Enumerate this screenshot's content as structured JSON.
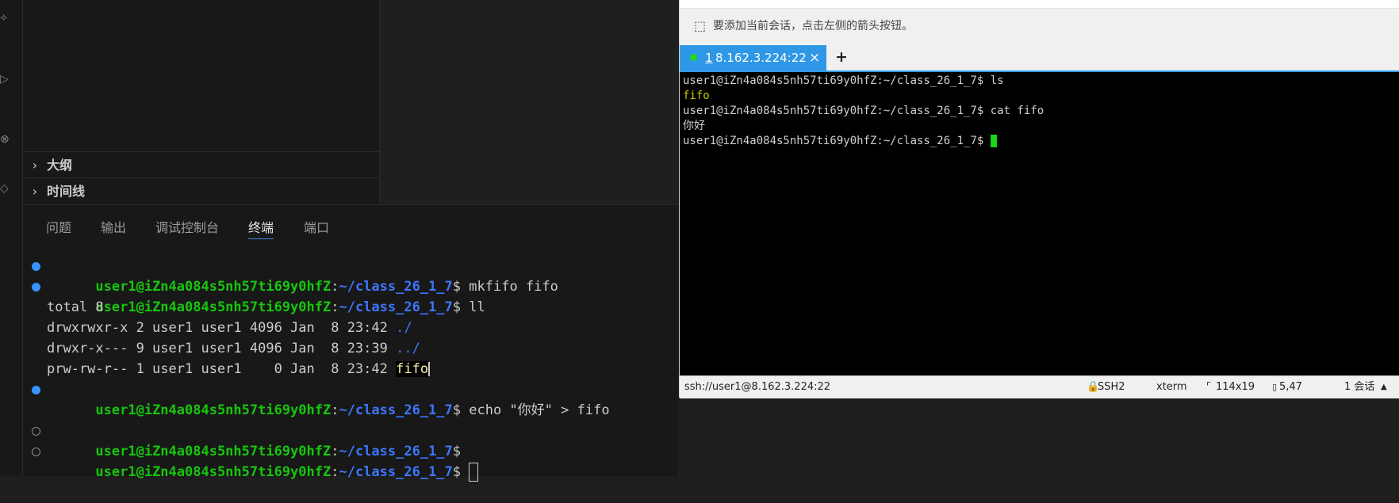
{
  "sidebar": {
    "sections": [
      {
        "label": "大纲"
      },
      {
        "label": "时间线"
      }
    ]
  },
  "panel": {
    "tabs": [
      {
        "label": "问题"
      },
      {
        "label": "输出"
      },
      {
        "label": "调试控制台"
      },
      {
        "label": "终端",
        "active": true
      },
      {
        "label": "端口"
      }
    ],
    "terminal": {
      "prompt_user": "user1@iZn4a084s5nh57ti69y0hfZ",
      "prompt_sep": ":",
      "prompt_path": "~/class_26_1_7",
      "prompt_sym": "$",
      "cmd1": " mkfifo fifo",
      "cmd2": " ll",
      "out_total": "total 8",
      "ls1_text": "drwxrwxr-x 2 user1 user1 4096 Jan  8 23:42 ",
      "ls1_name": "./",
      "ls2_text": "drwxr-x--- 9 user1 user1 4096 Jan  8 23:39 ",
      "ls2_name": "../",
      "ls3_text": "prw-rw-r-- 1 user1 user1    0 Jan  8 23:42 ",
      "ls3_name": "fifo",
      "cmd3": " echo \"你好\" > fifo"
    }
  },
  "ssh": {
    "hint": "要添加当前会话，点击左侧的箭头按钮。",
    "tab": {
      "number": "1",
      "label": "8.162.3.224:22"
    },
    "new_tab_label": "+",
    "close_label": "×",
    "terminal": {
      "line1": "user1@iZn4a084s5nh57ti69y0hfZ:~/class_26_1_7$ ls",
      "line2": "fifo",
      "line3": "user1@iZn4a084s5nh57ti69y0hfZ:~/class_26_1_7$ cat fifo",
      "line4": "你好",
      "line5": "user1@iZn4a084s5nh57ti69y0hfZ:~/class_26_1_7$ "
    },
    "status": {
      "url": "ssh://user1@8.162.3.224:22",
      "protocol": "SSH2",
      "term": "xterm",
      "size": "114x19",
      "cursor_pos": "5,47",
      "sessions": "1 会话"
    }
  },
  "colors": {
    "prompt_user": "#16c60c",
    "prompt_path": "#3b78ff",
    "tab_accent": "#2f98e6",
    "ssh_cursor": "#17d617"
  }
}
